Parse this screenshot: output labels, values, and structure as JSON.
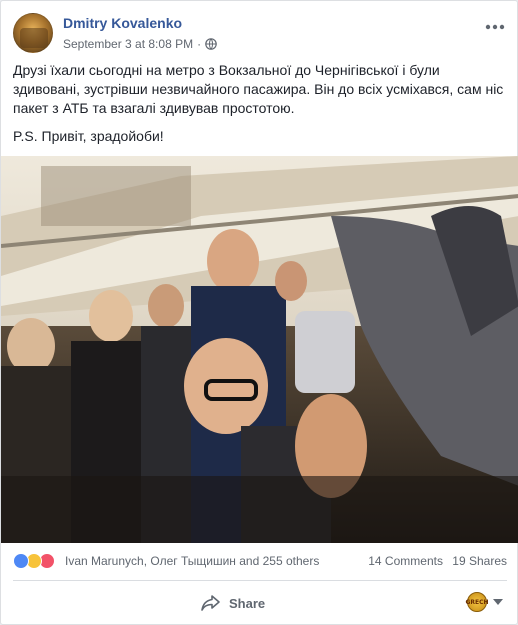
{
  "post": {
    "author": "Dmitry Kovalenko",
    "timestamp": "September 3 at 8:08 PM",
    "separator": "·",
    "privacy_icon": "globe-icon",
    "options_icon": "more-options-icon",
    "text_paragraphs": [
      "Друзі їхали сьогодні на метро з Вокзальної до Чернігівської і були здивовані, зустрівши незвичайного пасажира. Він до всіх усміхався, сам ніс пакет з АТБ та взагалі здивував простотою.",
      "P.S. Привіт, зрадойоби!"
    ],
    "photo_description": "photo"
  },
  "reactions": {
    "icons": [
      "like-reaction-icon",
      "haha-reaction-icon",
      "love-reaction-icon"
    ],
    "summary": "Ivan Marunych, Олег Тыщишин and 255 others",
    "comments": "14 Comments",
    "shares": "19 Shares"
  },
  "actions": {
    "share_label": "Share",
    "share_icon": "share-arrow-icon",
    "page_avatar_text": "GRECH"
  },
  "colors": {
    "link": "#365899",
    "meta": "#616770",
    "like": "#4e88f5",
    "haha": "#f7c33a",
    "love": "#f25268"
  }
}
